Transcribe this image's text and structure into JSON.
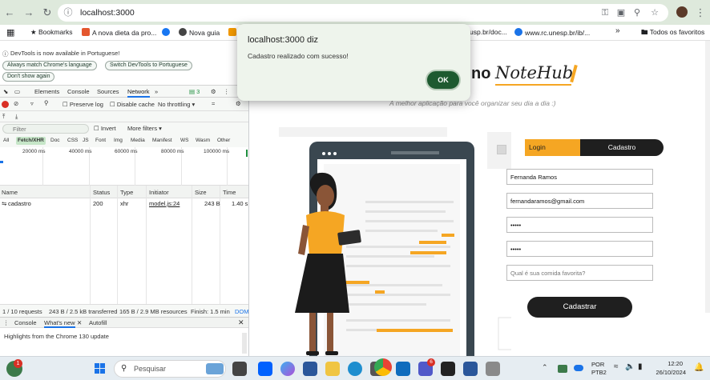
{
  "browser": {
    "url": "localhost:3000",
    "bookmarks": [
      {
        "label": "Bookmarks"
      },
      {
        "label": "A nova dieta da pro..."
      },
      {
        "label": "Nova guia"
      },
      {
        "label": "usp.br/doc..."
      },
      {
        "label": "www.rc.unesp.br/ib/..."
      },
      {
        "label": "Todos os favoritos"
      }
    ]
  },
  "devtools": {
    "info_message": "DevTools is now available in Portuguese!",
    "info_buttons": [
      "Always match Chrome's language",
      "Switch DevTools to Portuguese",
      "Don't show again"
    ],
    "tabs": [
      "Elements",
      "Console",
      "Sources",
      "Network"
    ],
    "issues_count": "3",
    "preserve_log": "Preserve log",
    "disable_cache": "Disable cache",
    "throttling": "No throttling",
    "filter_placeholder": "Filter",
    "invert": "Invert",
    "more_filters": "More filters",
    "type_filters": [
      "All",
      "Fetch/XHR",
      "Doc",
      "CSS",
      "JS",
      "Font",
      "Img",
      "Media",
      "Manifest",
      "WS",
      "Wasm",
      "Other"
    ],
    "timeline_ticks": [
      "20000 ms",
      "40000 ms",
      "60000 ms",
      "80000 ms",
      "100000 ms"
    ],
    "columns": [
      "Name",
      "Status",
      "Type",
      "Initiator",
      "Size",
      "Time"
    ],
    "rows": [
      {
        "name": "cadastro",
        "status": "200",
        "type": "xhr",
        "initiator": "model.js:24",
        "size": "243 B",
        "time": "1.40 s"
      }
    ],
    "status_bar": {
      "requests": "1 / 10 requests",
      "transferred": "243 B / 2.5 kB transferred",
      "resources": "165 B / 2.9 MB resources",
      "finish": "Finish: 1.5 min",
      "dom": "DOM"
    },
    "drawer_tabs": [
      "Console",
      "What's new",
      "Autofill"
    ],
    "drawer_text": "Highlights from the Chrome 130 update"
  },
  "page": {
    "logo_prefix": "no",
    "logo_text": "NoteHub",
    "tagline": "A melhor aplicação para você organizar seu dia a dia :)",
    "tab_login": "Login",
    "tab_cadastro": "Cadastro",
    "name_value": "Fernanda Ramos",
    "email_value": "fernandaramos@gmail.com",
    "password_value": "•••••",
    "confirm_value": "•••••",
    "food_placeholder": "Qual é sua comida favorita?",
    "submit_label": "Cadastrar",
    "colors": {
      "accent": "#f5a623",
      "dark": "#1f1f1f"
    }
  },
  "dialog": {
    "title": "localhost:3000 diz",
    "message": "Cadastro realizado com sucesso!",
    "ok_label": "OK"
  },
  "taskbar": {
    "search_placeholder": "Pesquisar",
    "language": "POR",
    "layout": "PTB2",
    "time": "12:20",
    "date": "26/10/2024",
    "notification_badge": "1",
    "teams_badge": "6"
  }
}
